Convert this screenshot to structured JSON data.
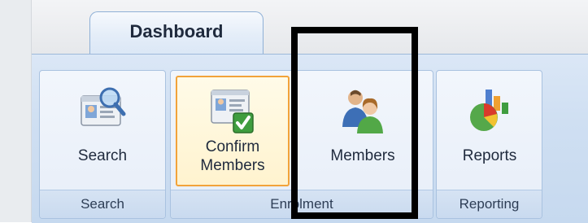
{
  "tabs": [
    {
      "label": "Dashboard",
      "active": true
    }
  ],
  "groups": {
    "search": {
      "caption": "Search",
      "buttons": [
        {
          "label": "Search",
          "icon": "search-card-icon"
        }
      ]
    },
    "enrolment": {
      "caption": "Enrolment",
      "buttons": [
        {
          "label_line1": "Confirm",
          "label_line2": "Members",
          "icon": "confirm-members-icon",
          "selected": true
        },
        {
          "label": "Members",
          "icon": "members-icon"
        }
      ]
    },
    "reporting": {
      "caption": "Reporting",
      "buttons": [
        {
          "label": "Reports",
          "icon": "reports-chart-icon"
        }
      ]
    }
  },
  "colors": {
    "ribbon_bg": "#cfdff2",
    "selected_border": "#f2a33a",
    "highlight_box": "#000000"
  }
}
